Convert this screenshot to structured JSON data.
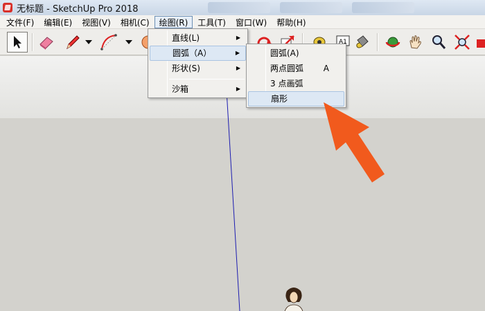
{
  "window": {
    "title": "无标题 - SketchUp Pro 2018"
  },
  "menubar": {
    "items": [
      "文件(F)",
      "编辑(E)",
      "视图(V)",
      "相机(C)",
      "绘图(R)",
      "工具(T)",
      "窗口(W)",
      "帮助(H)"
    ],
    "active_index": 4
  },
  "toolbar": {
    "tools": [
      "select-tool",
      "eraser-tool",
      "pencil-tool",
      "line-dropdown",
      "arc-tool",
      "arc-dropdown",
      "shape-tool",
      "rotate-tool",
      "scale-tool",
      "tape-tool",
      "text-tool",
      "paint-tool",
      "orbit-tool",
      "pan-tool",
      "zoom-tool",
      "zoom-extents-tool",
      "next-tool"
    ]
  },
  "draw_menu": {
    "items": [
      {
        "label": "直线(L)",
        "has_submenu": true
      },
      {
        "label": "圆弧（A）",
        "has_submenu": true,
        "highlighted": true
      },
      {
        "label": "形状(S)",
        "has_submenu": true
      },
      {
        "label": "沙箱",
        "has_submenu": true
      }
    ]
  },
  "arc_submenu": {
    "items": [
      {
        "label": "圆弧(A)",
        "accel": ""
      },
      {
        "label": "两点圆弧",
        "accel": "A"
      },
      {
        "label": "3 点画弧",
        "accel": ""
      },
      {
        "label": "扇形",
        "accel": "",
        "highlighted": true
      }
    ]
  },
  "colors": {
    "annotation_arrow": "#f15a1d",
    "axis_blue": "#1c1cb0",
    "highlight": "#dde8f4"
  }
}
